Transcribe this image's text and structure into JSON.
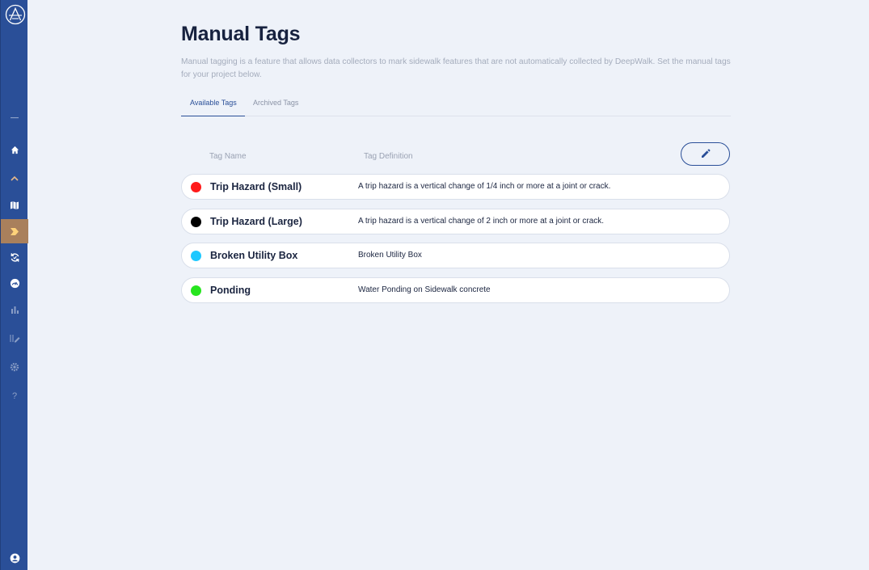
{
  "page": {
    "title": "Manual Tags",
    "description": "Manual tagging is a feature that allows data collectors to mark sidewalk features that are not automatically collected by DeepWalk. Set the manual tags for your project below."
  },
  "tabs": [
    {
      "label": "Available Tags",
      "active": true
    },
    {
      "label": "Archived Tags",
      "active": false
    }
  ],
  "table": {
    "headers": {
      "name": "Tag Name",
      "definition": "Tag Definition"
    },
    "rows": [
      {
        "name": "Trip Hazard (Small)",
        "definition": "A trip hazard is a vertical change of 1/4 inch or more at a joint or crack.",
        "color": "#ff1a1a"
      },
      {
        "name": "Trip Hazard (Large)",
        "definition": "A trip hazard is a vertical change of 2 inch or more at a joint or crack.",
        "color": "#000000"
      },
      {
        "name": "Broken Utility Box",
        "definition": "Broken Utility Box",
        "color": "#1ec8ff"
      },
      {
        "name": "Ponding",
        "definition": "Water Ponding on Sidewalk concrete",
        "color": "#27e51f"
      }
    ]
  },
  "sidebar": {
    "items": [
      {
        "icon": "home-icon"
      },
      {
        "icon": "chevron-up-icon"
      },
      {
        "icon": "map-icon"
      },
      {
        "icon": "tag-icon",
        "active": true
      },
      {
        "icon": "sync-icon"
      },
      {
        "icon": "gauge-icon"
      },
      {
        "icon": "bar-chart-icon"
      },
      {
        "icon": "list-edit-icon"
      },
      {
        "icon": "settings-icon"
      },
      {
        "icon": "help-icon",
        "text": "?"
      },
      {
        "icon": "user-icon"
      }
    ]
  },
  "colors": {
    "sidebar": "#2a4f98",
    "sidebar_active": "#a9805c",
    "accent": "#2a4f98",
    "background": "#eef2f9"
  }
}
